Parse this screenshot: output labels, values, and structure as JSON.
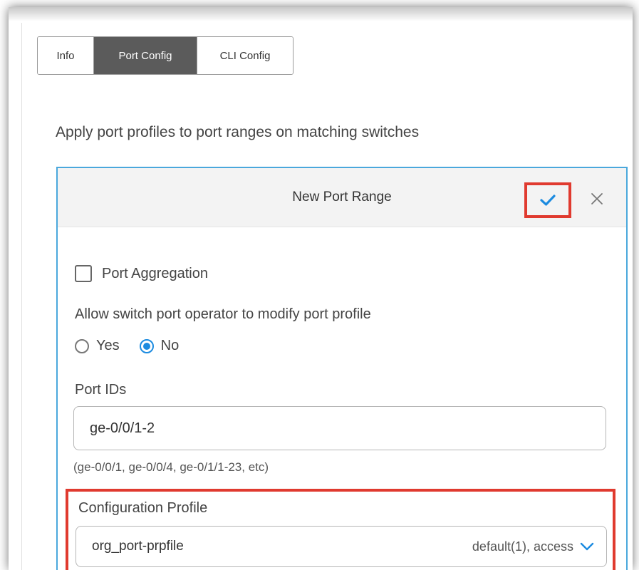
{
  "tabs": [
    {
      "label": "Info"
    },
    {
      "label": "Port Config"
    },
    {
      "label": "CLI Config"
    }
  ],
  "intro_text": "Apply port profiles to port ranges on matching switches",
  "card": {
    "title": "New Port Range",
    "confirm_icon": "checkmark-icon",
    "close_icon": "close-icon"
  },
  "port_aggregation": {
    "label": "Port Aggregation",
    "checked": false
  },
  "allow_modify": {
    "label": "Allow switch port operator to modify port profile",
    "options": [
      {
        "label": "Yes",
        "selected": false
      },
      {
        "label": "No",
        "selected": true
      }
    ]
  },
  "port_ids": {
    "label": "Port IDs",
    "value": "ge-0/0/1-2",
    "hint": "(ge-0/0/1, ge-0/0/4, ge-0/1/1-23, etc)"
  },
  "config_profile": {
    "label": "Configuration Profile",
    "value": "org_port-prpfile",
    "meta": "default(1), access"
  },
  "colors": {
    "accent": "#1c8be0",
    "highlight": "#e03a2f",
    "card_border": "#4aa8dc",
    "active_tab": "#5b5b5b"
  }
}
